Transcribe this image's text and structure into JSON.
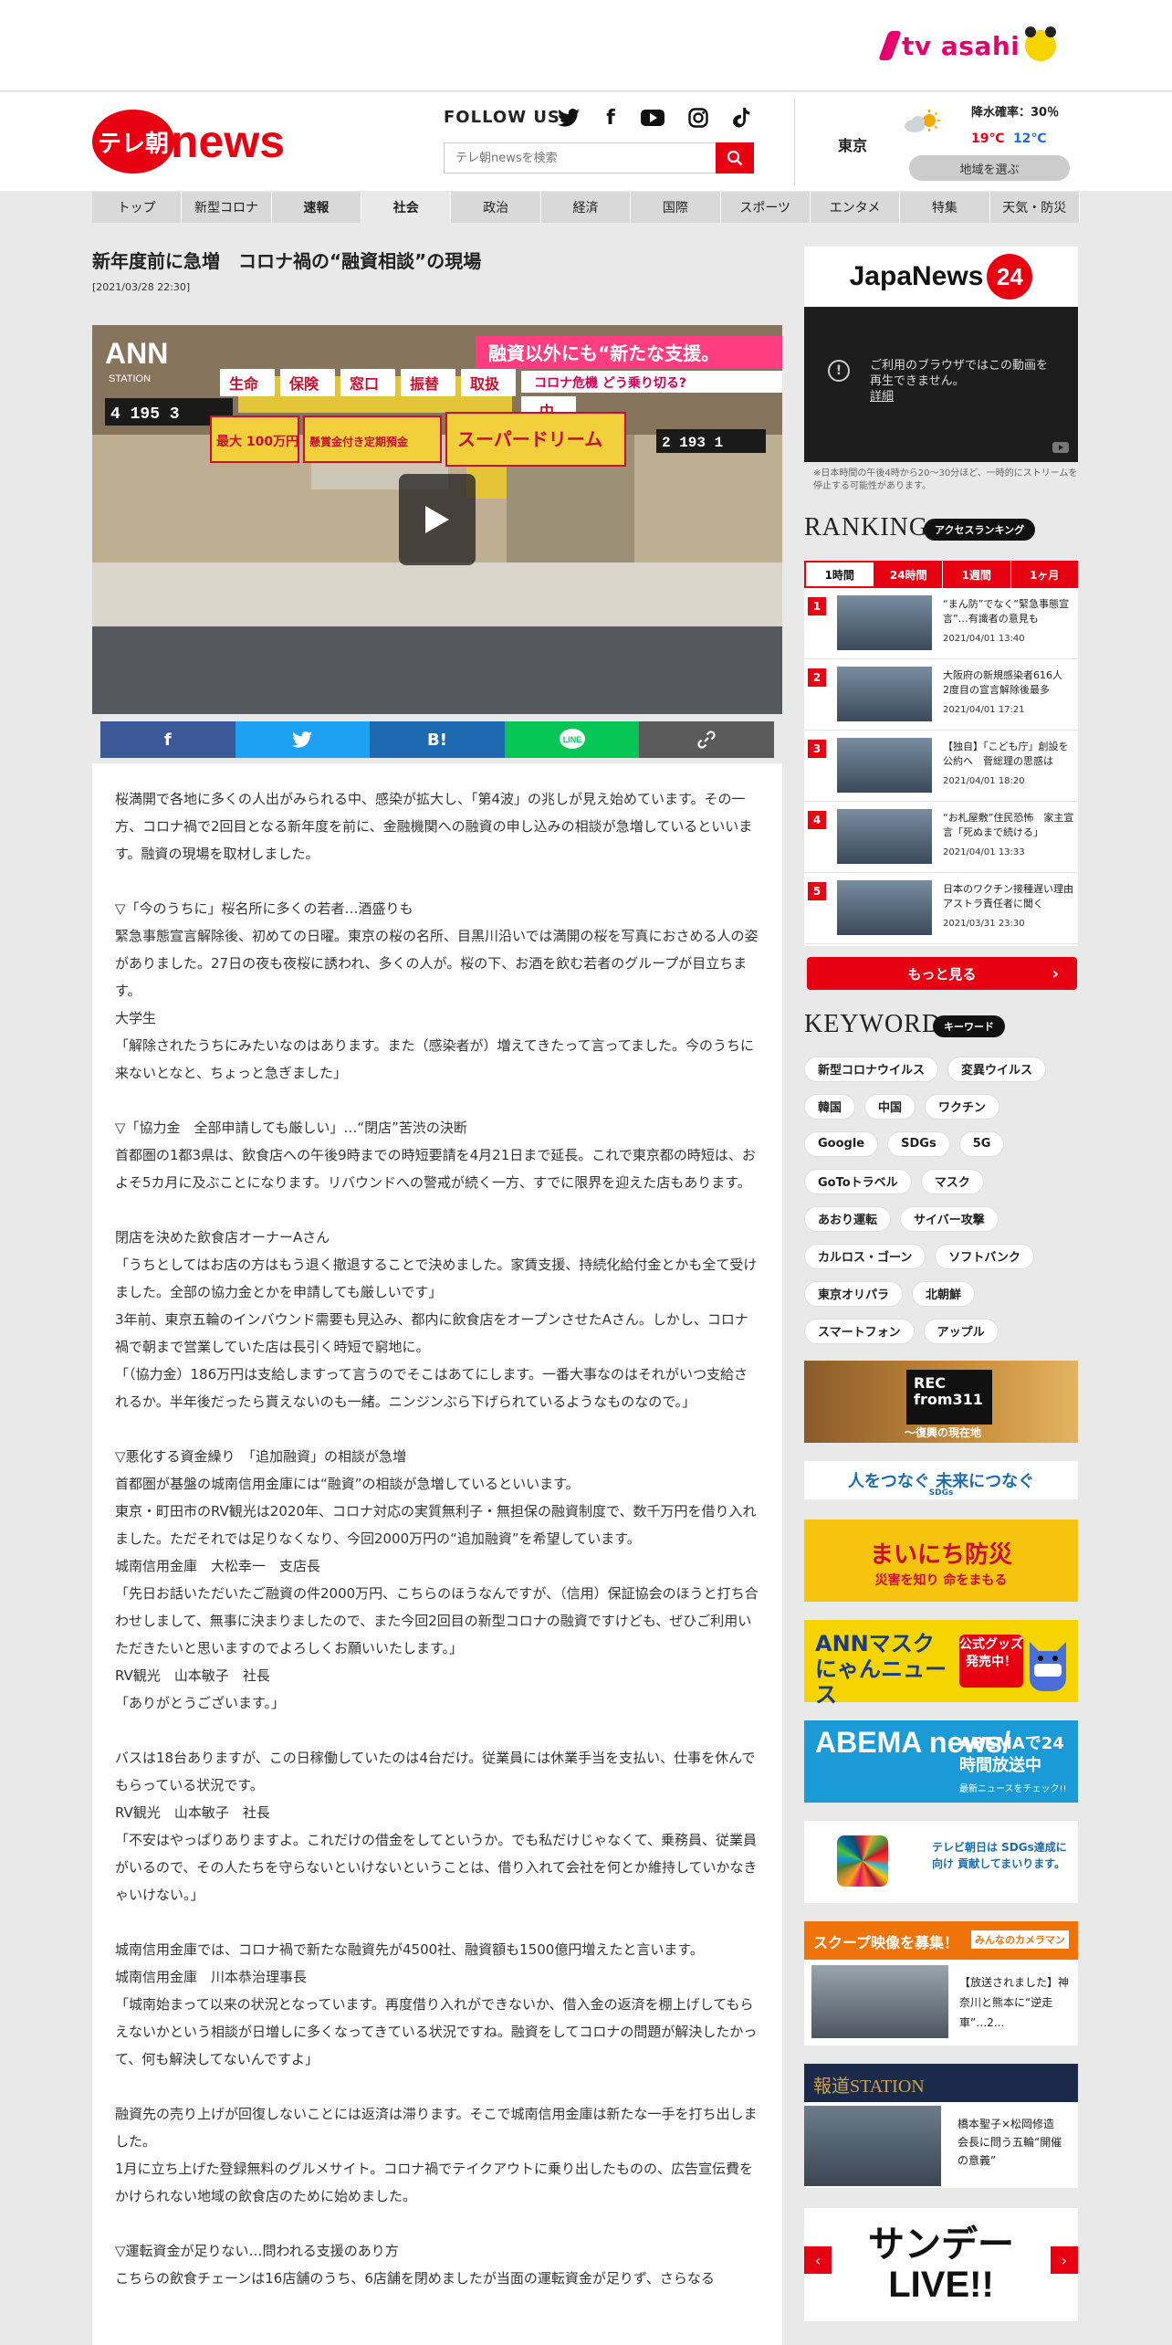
{
  "topbar": {
    "brand": "tv asahi"
  },
  "header": {
    "logo_badge": "テレ朝",
    "logo_text": "news",
    "follow_label": "FOLLOW US",
    "search_placeholder": "テレ朝newsを検索",
    "weather": {
      "city": "東京",
      "rain_label": "降水確率：30％",
      "high": "19℃",
      "low": "12℃",
      "region_button": "地域を選ぶ"
    }
  },
  "nav": {
    "items": [
      "トップ",
      "新型コロナ",
      "速報",
      "社会",
      "政治",
      "経済",
      "国際",
      "スポーツ",
      "エンタメ",
      "特集",
      "天気・防災"
    ],
    "active": "社会"
  },
  "article": {
    "title": "新年度前に急増　コロナ禍の“融資相談”の現場",
    "date": "[2021/03/28 22:30]",
    "video": {
      "station_logo": "ANN",
      "station_label": "STATION",
      "caption_main": "融資以外にも“新たな支援。",
      "caption_sub": "コロナ危機 どう乗り切る?",
      "signs": [
        "生命",
        "保険",
        "窓口",
        "振替",
        "取扱",
        "中"
      ],
      "counter_left": "4 195 3",
      "counter_right": "2 193 1",
      "poster_left": "最大 100万円",
      "poster_mid": "懸賞金付き定期預金",
      "poster_right": "スーパードリーム"
    },
    "share": [
      "f",
      "twitter",
      "B!",
      "LINE",
      "link"
    ],
    "paragraphs": [
      "桜満開で各地に多くの人出がみられる中、感染が拡大し、「第4波」の兆しが見え始めています。その一方、コロナ禍で2回目となる新年度を前に、金融機関への融資の申し込みの相談が急増しているといいます。融資の現場を取材しました。",
      "",
      "▽「今のうちに」桜名所に多くの若者…酒盛りも",
      "緊急事態宣言解除後、初めての日曜。東京の桜の名所、目黒川沿いでは満開の桜を写真におさめる人の姿がありました。27日の夜も夜桜に誘われ、多くの人が。桜の下、お酒を飲む若者のグループが目立ちます。",
      "大学生",
      "「解除されたうちにみたいなのはあります。また（感染者が）増えてきたって言ってました。今のうちに来ないとなと、ちょっと急ぎました」",
      "",
      "▽「協力金　全部申請しても厳しい」…“閉店”苦渋の決断",
      "首都圏の1都3県は、飲食店への午後9時までの時短要請を4月21日まで延長。これで東京都の時短は、およそ5カ月に及ぶことになります。リバウンドへの警戒が続く一方、すでに限界を迎えた店もあります。",
      "",
      "閉店を決めた飲食店オーナーAさん",
      "「うちとしてはお店の方はもう退く撤退することで決めました。家賃支援、持続化給付金とかも全て受けました。全部の協力金とかを申請しても厳しいです」",
      "3年前、東京五輪のインバウンド需要も見込み、都内に飲食店をオープンさせたAさん。しかし、コロナ禍で朝まで営業していた店は長引く時短で窮地に。",
      "「（協力金）186万円は支給しますって言うのでそこはあてにします。一番大事なのはそれがいつ支給されるか。半年後だったら貰えないのも一緒。ニンジンぶら下げられているようなものなので。」",
      "",
      "▽悪化する資金繰り　「追加融資」の相談が急増",
      "首都圏が基盤の城南信用金庫には“融資”の相談が急増しているといいます。",
      "東京・町田市のRV観光は2020年、コロナ対応の実質無利子・無担保の融資制度で、数千万円を借り入れました。ただそれでは足りなくなり、今回2000万円の“追加融資”を希望しています。",
      "城南信用金庫　大松幸一　支店長",
      "「先日お話いただいたご融資の件2000万円、こちらのほうなんですが、（信用）保証協会のほうと打ち合わせしまして、無事に決まりましたので、また今回2回目の新型コロナの融資ですけども、ぜひご利用いただきたいと思いますのでよろしくお願いいたします。」",
      "RV観光　山本敏子　社長",
      "「ありがとうございます。」",
      "",
      "バスは18台ありますが、この日稼働していたのは4台だけ。従業員には休業手当を支払い、仕事を休んでもらっている状況です。",
      "RV観光　山本敏子　社長",
      "「不安はやっぱりありますよ。これだけの借金をしてというか。でも私だけじゃなくて、乗務員、従業員がいるので、その人たちを守らないといけないということは、借り入れて会社を何とか維持していかなきゃいけない。」",
      "",
      "城南信用金庫では、コロナ禍で新たな融資先が4500社、融資額も1500億円増えたと言います。",
      "城南信用金庫　川本恭治理事長",
      "「城南始まって以来の状況となっています。再度借り入れができないか、借入金の返済を棚上げしてもらえないかという相談が日増しに多くなってきている状況ですね。融資をしてコロナの問題が解決したかって、何も解決してないんですよ」",
      "",
      "融資先の売り上げが回復しないことには返済は滞ります。そこで城南信用金庫は新たな一手を打ち出しました。",
      "1月に立ち上げた登録無料のグルメサイト。コロナ禍でテイクアウトに乗り出したものの、広告宣伝費をかけられない地域の飲食店のために始めました。",
      "",
      "▽運転資金が足りない…問われる支援のあり方",
      "こちらの飲食チェーンは16店舗のうち、6店舗を閉めましたが当面の運転資金が足りず、さらなる"
    ]
  },
  "sidebar": {
    "japanews": {
      "logo_text": "JapaNews",
      "logo_num": "24",
      "message": "ご利用のブラウザではこの動画を再生できません。",
      "detail_link": "詳細",
      "note": "※日本時間の午後4時から20～30分ほど、一時的にストリームを停止する可能性があります。"
    },
    "ranking": {
      "title": "RANKING",
      "badge": "アクセスランキング",
      "tabs": [
        "1時間",
        "24時間",
        "1週間",
        "1ヶ月"
      ],
      "active_tab": "1時間",
      "items": [
        {
          "rank": "1",
          "text": "“まん防”でなく“緊急事態宣言”…有識者の意見も",
          "date": "2021/04/01 13:40"
        },
        {
          "rank": "2",
          "text": "大阪府の新規感染者616人　2度目の宣言解除後最多",
          "date": "2021/04/01 17:21"
        },
        {
          "rank": "3",
          "text": "【独自】「こども庁」創設を公約へ　菅総理の思惑は",
          "date": "2021/04/01 18:20"
        },
        {
          "rank": "4",
          "text": "“お札屋敷”住民恐怖　家主宣言「死ぬまで続ける」",
          "date": "2021/04/01 13:33"
        },
        {
          "rank": "5",
          "text": "日本のワクチン接種遅い理由　アストラ責任者に聞く",
          "date": "2021/03/31 23:30"
        }
      ],
      "more_button": "もっと見る"
    },
    "keyword": {
      "title": "KEYWORD",
      "badge": "キーワード",
      "rows": [
        [
          "新型コロナウイルス",
          "変異ウイルス"
        ],
        [
          "韓国",
          "中国",
          "ワクチン"
        ],
        [
          "Google",
          "SDGs",
          "5G"
        ],
        [
          "GoToトラベル",
          "マスク"
        ],
        [
          "あおり運転",
          "サイバー攻撃"
        ],
        [
          "カルロス・ゴーン",
          "ソフトバンク"
        ],
        [
          "東京オリパラ",
          "北朝鮮"
        ],
        [
          "スマートフォン",
          "アップル"
        ]
      ]
    },
    "banners": {
      "rec": {
        "title": "REC from311",
        "sub": "～復興の現在地"
      },
      "sdgs1": "人をつなぐ 未来につなぐ",
      "sdgs1_sub": "SDGs",
      "bousai": {
        "title": "まいにち防災",
        "sub": "災害を知り 命をまもる"
      },
      "mask": {
        "title": "ANNマスクにゃんニュース",
        "badge": "公式グッズ発売中！"
      },
      "abema": {
        "left": "ABEMA news/",
        "right": "ABEMAで24時間放送中",
        "sub": "最新ニュースをチェック!!"
      },
      "sdgs2": "テレビ朝日は SDGs達成に向け 貢献してまいります。",
      "scoop": {
        "head": "スクープ映像を募集！",
        "logo": "みんなのカメラマン",
        "text": "【放送されました】神奈川と熊本に“逆走車”…2..."
      },
      "station": {
        "head": "報道STATION",
        "text": "橋本聖子×松岡修造　会長に問う五輪“開催の意義”"
      },
      "sunday": {
        "title": "サンデーLIVE!!"
      }
    }
  }
}
